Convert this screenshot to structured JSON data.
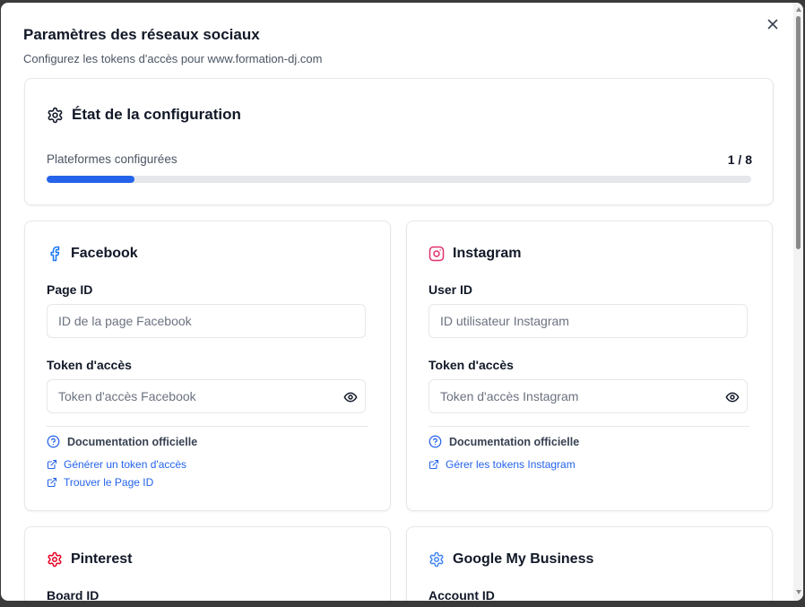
{
  "dialog": {
    "title": "Paramètres des réseaux sociaux",
    "subtitle": "Configurez les tokens d'accès pour www.formation-dj.com"
  },
  "status": {
    "title": "État de la configuration",
    "label": "Plateformes configurées",
    "count": "1 / 8",
    "progress_fraction": 0.125
  },
  "platforms": [
    {
      "name": "Facebook",
      "icon": "facebook-icon",
      "color": "#1877f2",
      "field1_label": "Page ID",
      "field1_placeholder": "ID de la page Facebook",
      "field2_label": "Token d'accès",
      "field2_placeholder": "Token d'accès Facebook",
      "doc_title": "Documentation officielle",
      "links": [
        "Générer un token d'accès",
        "Trouver le Page ID"
      ]
    },
    {
      "name": "Instagram",
      "icon": "instagram-icon",
      "color": "#e1306c",
      "field1_label": "User ID",
      "field1_placeholder": "ID utilisateur Instagram",
      "field2_label": "Token d'accès",
      "field2_placeholder": "Token d'accès Instagram",
      "doc_title": "Documentation officielle",
      "links": [
        "Gérer les tokens Instagram"
      ]
    },
    {
      "name": "Pinterest",
      "icon": "gear-icon",
      "color": "#e60023",
      "field1_label": "Board ID"
    },
    {
      "name": "Google My Business",
      "icon": "gear-icon",
      "color": "#4285f4",
      "field1_label": "Account ID"
    }
  ]
}
